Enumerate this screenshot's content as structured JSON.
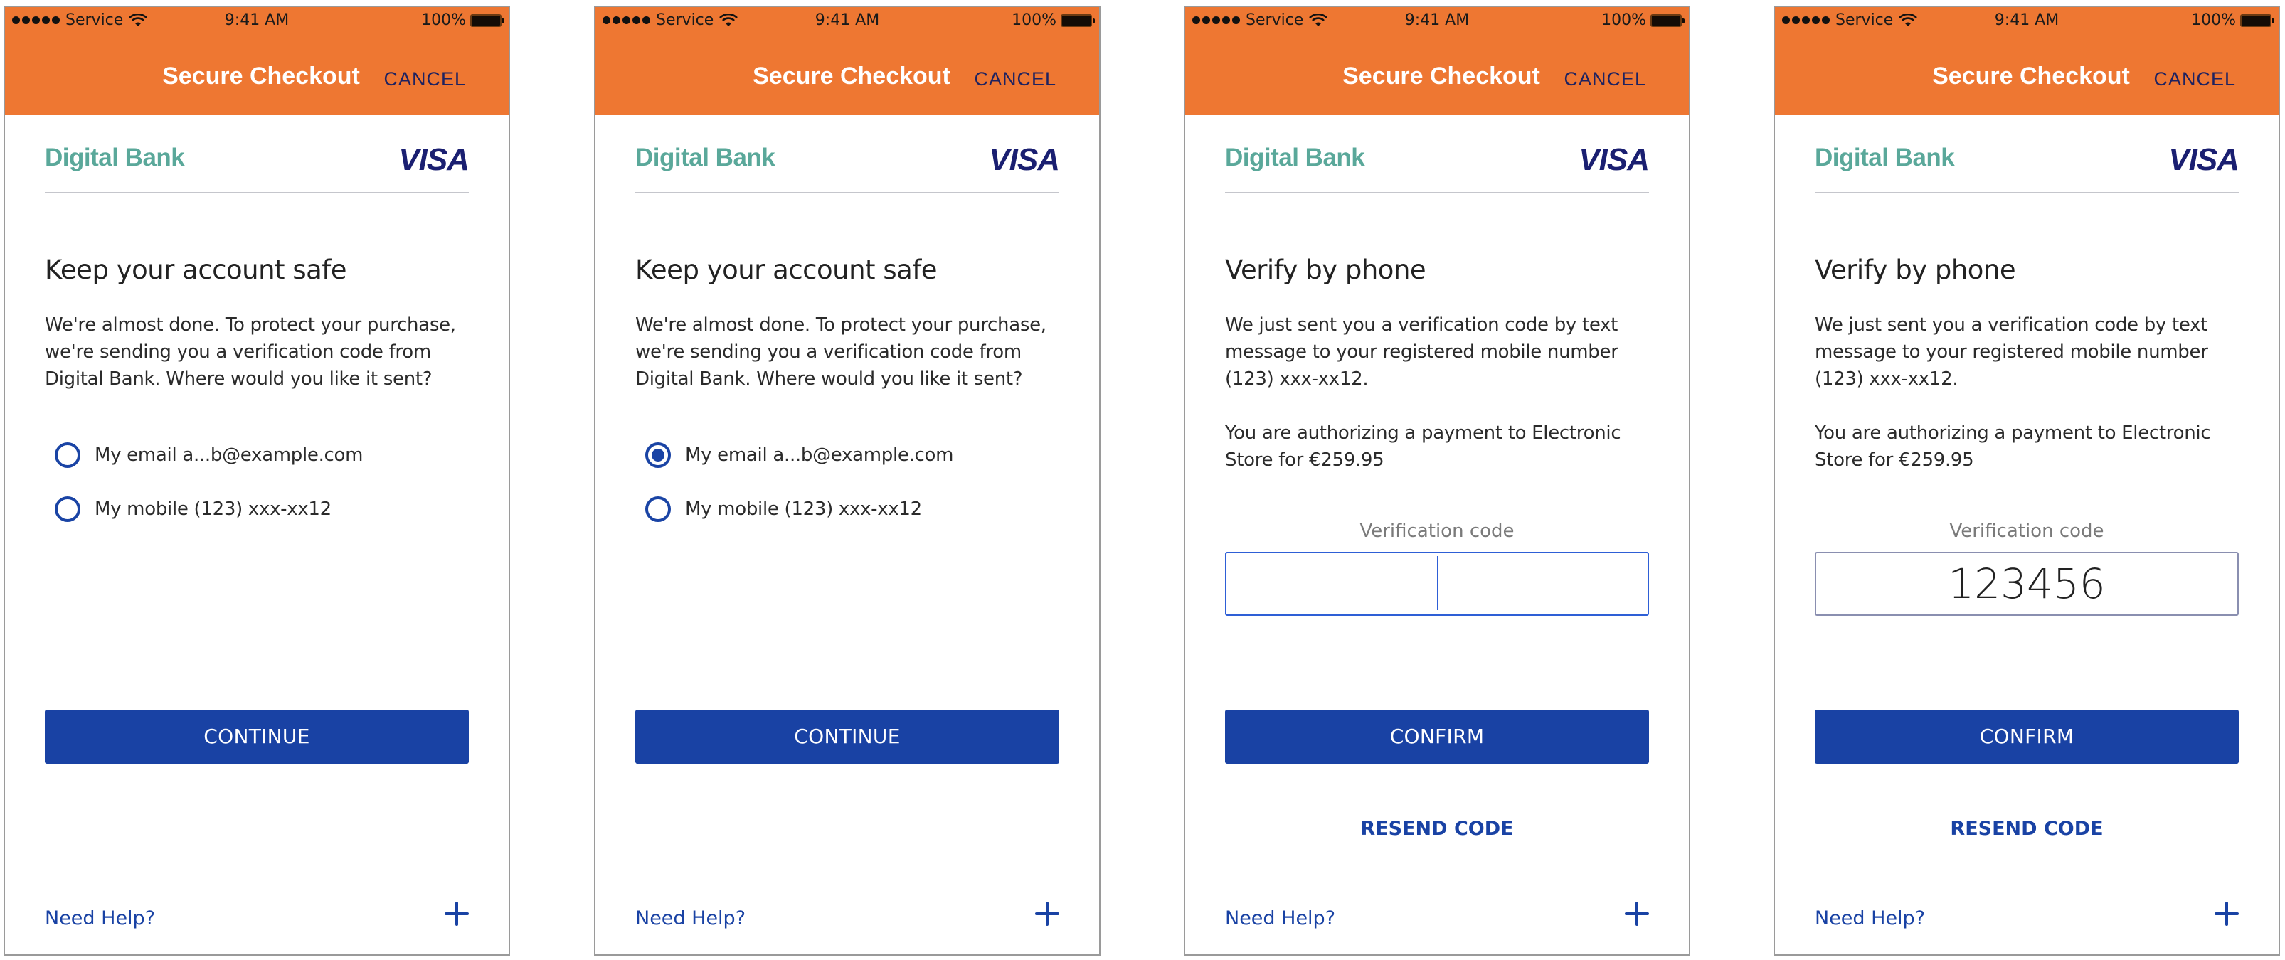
{
  "colors": {
    "header_bg": "#ee7732",
    "primary": "#1942a4",
    "brand_green": "#5aa89a",
    "visa_navy": "#1a1f71",
    "cancel_navy": "#1e2260"
  },
  "status_bar": {
    "carrier": "Service",
    "time": "9:41 AM",
    "battery": "100%",
    "icons": [
      "signal-dots-icon",
      "wifi-icon",
      "battery-icon"
    ]
  },
  "header": {
    "title": "Secure Checkout",
    "cancel_label": "CANCEL"
  },
  "brand": {
    "bank_name": "Digital Bank",
    "card_network": "VISA"
  },
  "footer": {
    "help_label": "Need Help?",
    "expand_icon": "plus-icon"
  },
  "screens": [
    {
      "heading": "Keep your account safe",
      "paragraph": "We're almost done. To protect your purchase, we're sending you a verification code from Digital Bank. Where would you like it sent?",
      "options": [
        {
          "label": "My email a...b@example.com",
          "selected": false
        },
        {
          "label": "My mobile (123) xxx-xx12",
          "selected": false
        }
      ],
      "button_label": "CONTINUE"
    },
    {
      "heading": "Keep your account safe",
      "paragraph": "We're almost done. To protect your purchase, we're sending you a verification code from Digital Bank. Where would you like it sent?",
      "options": [
        {
          "label": "My email a...b@example.com",
          "selected": true
        },
        {
          "label": "My mobile (123) xxx-xx12",
          "selected": false
        }
      ],
      "button_label": "CONTINUE"
    },
    {
      "heading": "Verify by phone",
      "paragraph": "We just sent you a verification code by text message to your registered mobile number (123) xxx-xx12.",
      "paragraph2": "You are authorizing a payment to Electronic Store for €259.95",
      "input_label": "Verification code",
      "input_value": "",
      "button_label": "CONFIRM",
      "resend_label": "RESEND CODE"
    },
    {
      "heading": "Verify by phone",
      "paragraph": "We just sent you a verification code by text message to your registered mobile number (123) xxx-xx12.",
      "paragraph2": "You are authorizing a payment to Electronic Store for €259.95",
      "input_label": "Verification code",
      "input_value": "123456",
      "button_label": "CONFIRM",
      "resend_label": "RESEND CODE"
    }
  ]
}
